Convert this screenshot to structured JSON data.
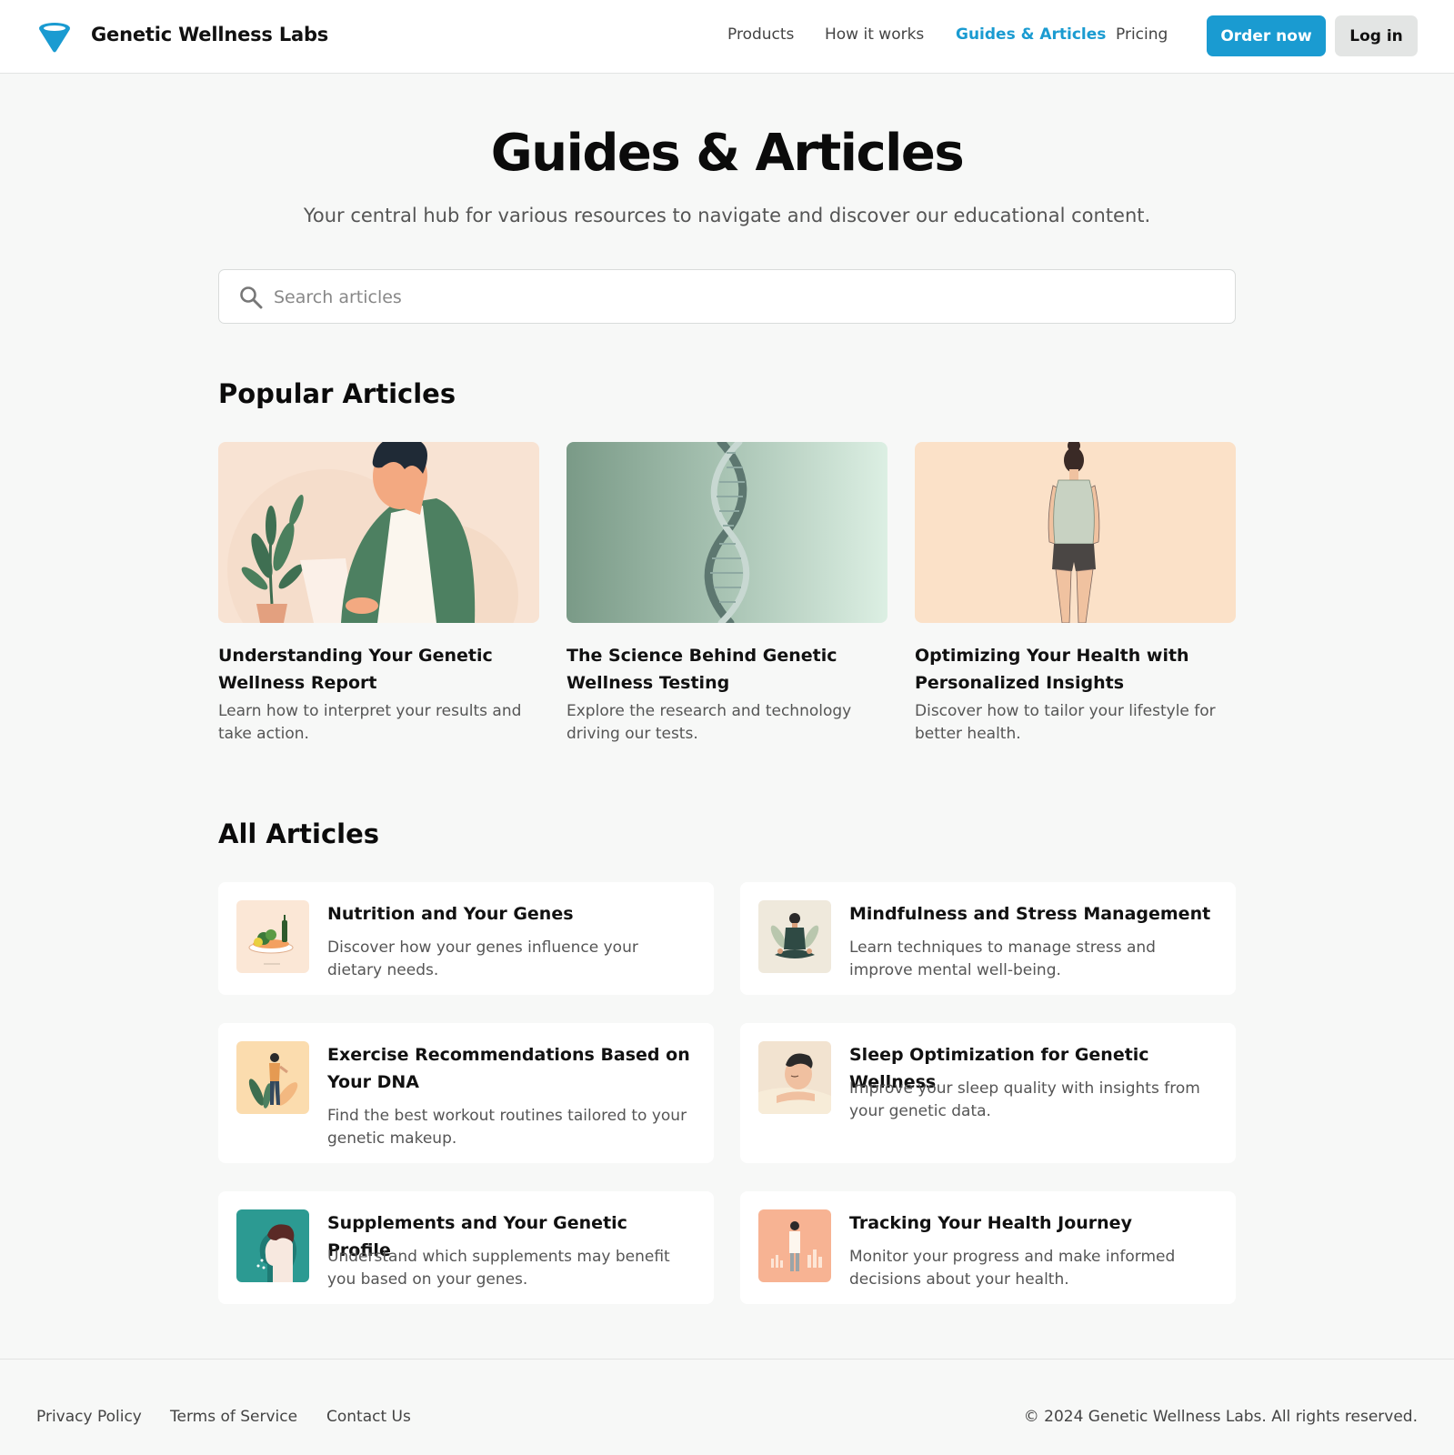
{
  "brand": {
    "name": "Genetic Wellness Labs",
    "accent_color": "#1a9bd1"
  },
  "nav": {
    "items": [
      {
        "label": "Products"
      },
      {
        "label": "How it works"
      },
      {
        "label": "Guides & Articles",
        "active": true
      },
      {
        "label": "Pricing"
      }
    ],
    "order_button": "Order now",
    "login_button": "Log in"
  },
  "hero": {
    "title": "Guides & Articles",
    "subtitle": "Your central hub for various resources to navigate and discover our educational content."
  },
  "search": {
    "placeholder": "Search articles",
    "value": ""
  },
  "popular": {
    "heading": "Popular Articles",
    "items": [
      {
        "title": "Understanding Your Genetic Wellness Report",
        "description": "Learn how to interpret your results and take action.",
        "image_icon": "person-reading-illustration"
      },
      {
        "title": "The Science Behind Genetic Wellness Testing",
        "description": "Explore the research and technology driving our tests.",
        "image_icon": "dna-helix-illustration"
      },
      {
        "title": "Optimizing Your Health with Personalized Insights",
        "description": "Discover how to tailor your lifestyle for better health.",
        "image_icon": "woman-standing-illustration"
      }
    ]
  },
  "all_articles": {
    "heading": "All Articles",
    "items": [
      {
        "title": "Nutrition and Your Genes",
        "description": "Discover how your genes influence your dietary needs.",
        "thumb_icon": "food-plate-icon"
      },
      {
        "title": "Mindfulness and Stress Management",
        "description": "Learn techniques to manage stress and improve mental well-being.",
        "thumb_icon": "meditation-icon"
      },
      {
        "title": "Exercise Recommendations Based on Your DNA",
        "description": "Find the best workout routines tailored to your genetic makeup.",
        "thumb_icon": "exercise-icon"
      },
      {
        "title": "Sleep Optimization for Genetic Wellness",
        "description": "Improve your sleep quality with insights from your genetic data.",
        "thumb_icon": "sleeping-person-icon"
      },
      {
        "title": "Supplements and Your Genetic Profile",
        "description": "Understand which supplements may benefit you based on your genes.",
        "thumb_icon": "head-profile-icon"
      },
      {
        "title": "Tracking Your Health Journey",
        "description": "Monitor your progress and make informed decisions about your health.",
        "thumb_icon": "health-tracking-icon"
      }
    ]
  },
  "footer": {
    "links": [
      {
        "label": "Privacy Policy"
      },
      {
        "label": "Terms of Service"
      },
      {
        "label": "Contact Us"
      }
    ],
    "copyright": "© 2024 Genetic Wellness Labs. All rights reserved."
  }
}
